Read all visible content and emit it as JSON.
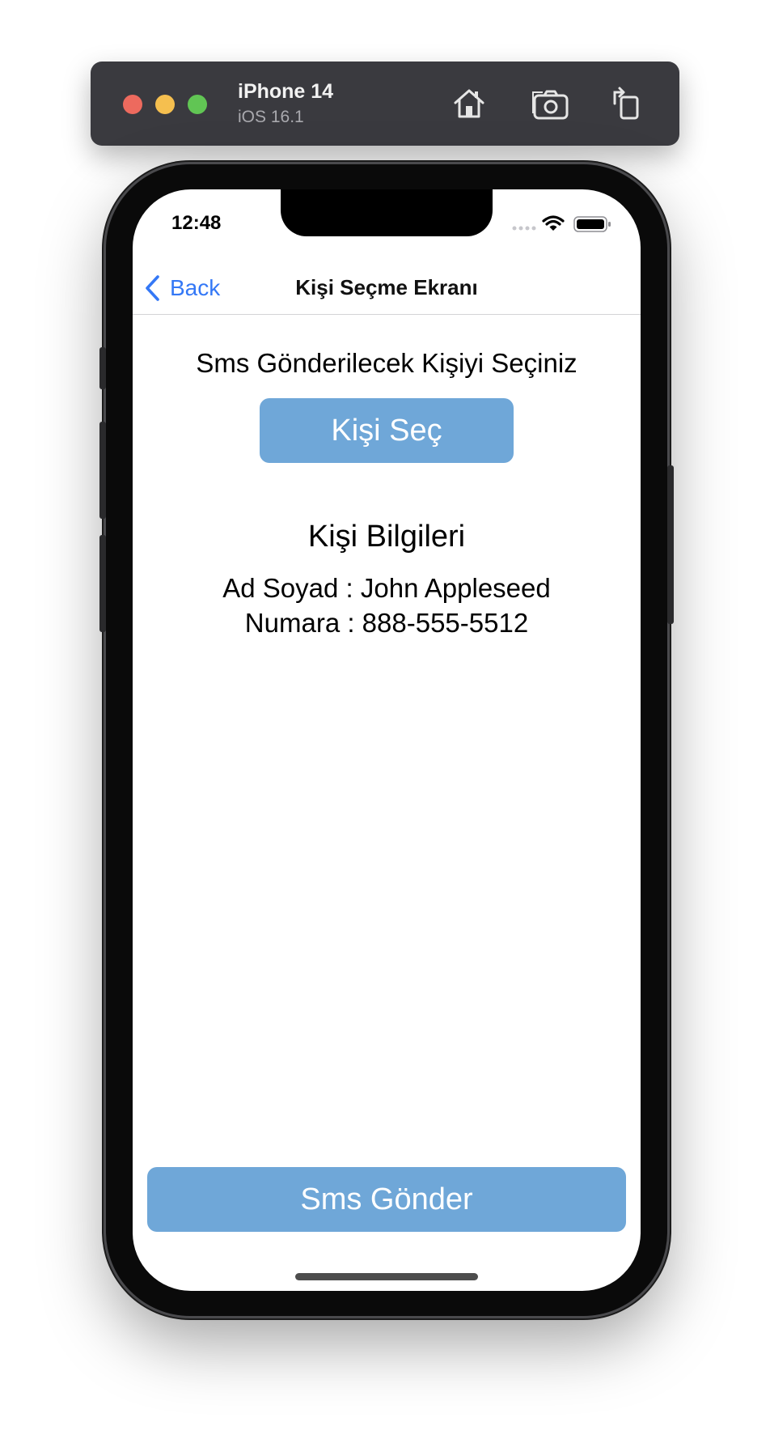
{
  "simulator": {
    "device_name": "iPhone 14",
    "os_version": "iOS 16.1",
    "buttons": {
      "home": "home-icon",
      "screenshot": "camera-icon",
      "rotate": "rotate-icon"
    }
  },
  "status_bar": {
    "time": "12:48",
    "icons": [
      "signal-icon",
      "wifi-icon",
      "battery-icon"
    ]
  },
  "nav": {
    "back_label": "Back",
    "title": "Kişi Seçme Ekranı"
  },
  "main": {
    "prompt": "Sms Gönderilecek Kişiyi Seçiniz",
    "pick_button_label": "Kişi Seç",
    "info_title": "Kişi Bilgileri",
    "name_line": "Ad Soyad : John Appleseed",
    "number_line": "Numara : 888-555-5512"
  },
  "footer": {
    "send_button_label": "Sms Gönder"
  },
  "colors": {
    "accent_button": "#6fa7d8",
    "ios_blue": "#3478f6"
  }
}
